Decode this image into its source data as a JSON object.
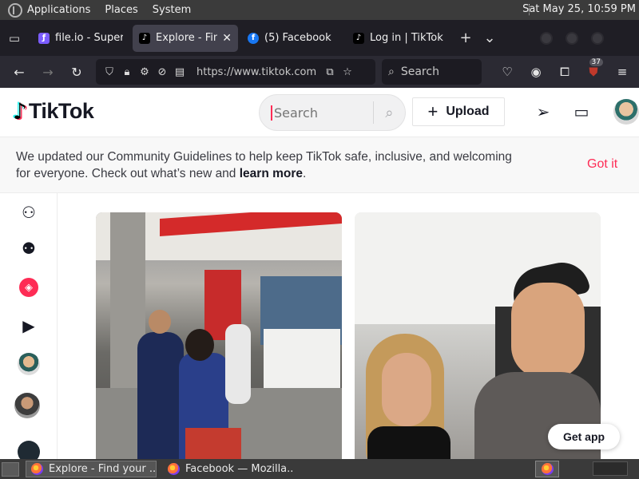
{
  "desktop": {
    "menus": [
      "Applications",
      "Places",
      "System"
    ],
    "clock": "Sat May 25, 10:59 PM"
  },
  "browser": {
    "tabs": [
      {
        "title": "file.io - Super s",
        "icon": "fileio-icon",
        "active": false
      },
      {
        "title": "Explore - Find",
        "icon": "tiktok-icon",
        "active": true
      },
      {
        "title": "(5) Facebook",
        "icon": "facebook-icon",
        "active": false
      },
      {
        "title": "Log in | TikTok",
        "icon": "tiktok-icon",
        "active": false
      }
    ],
    "url": "https://www.tiktok.com/",
    "search_placeholder": "Search",
    "extension_badge": "37"
  },
  "tiktok": {
    "logo_text": "TikTok",
    "search_placeholder": "Search",
    "upload_label": "Upload",
    "banner": {
      "message_line1": "We updated our Community Guidelines to help keep TikTok safe, inclusive, and welcoming",
      "message_line2_prefix": "for everyone. Check out what’s new and ",
      "learn_more": "learn more",
      "message_suffix": ".",
      "got_it": "Got it"
    },
    "get_app": "Get app",
    "sidenav_icons": [
      "following-icon",
      "friends-icon",
      "explore-icon",
      "live-icon",
      "avatar",
      "avatar",
      "avatar"
    ]
  },
  "taskbar": {
    "tasks": [
      {
        "title": "Explore - Find your ...",
        "active": true
      },
      {
        "title": "Facebook — Mozilla...",
        "active": false
      }
    ]
  },
  "colors": {
    "tiktok_red": "#fe2c55",
    "tiktok_cyan": "#25f4ee",
    "browser_dark": "#2b2a33"
  }
}
